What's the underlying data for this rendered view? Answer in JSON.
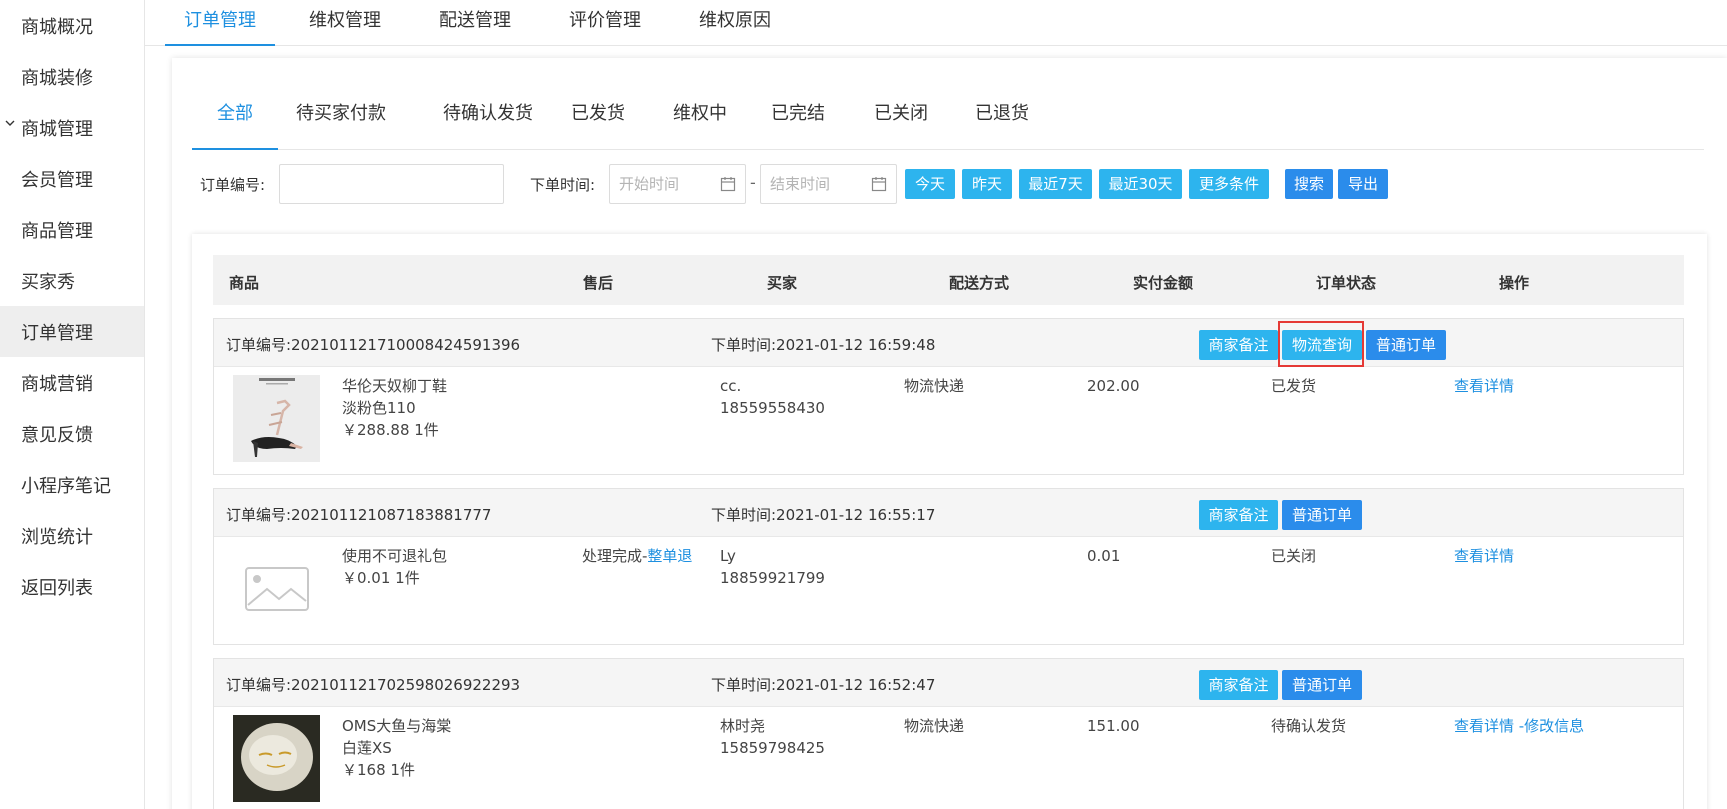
{
  "sidebar": {
    "items": [
      {
        "label": "商城概况"
      },
      {
        "label": "商城装修"
      },
      {
        "label": "商城管理"
      },
      {
        "label": "会员管理"
      },
      {
        "label": "商品管理"
      },
      {
        "label": "买家秀"
      },
      {
        "label": "订单管理"
      },
      {
        "label": "商城营销"
      },
      {
        "label": "意见反馈"
      },
      {
        "label": "小程序笔记"
      },
      {
        "label": "浏览统计"
      },
      {
        "label": "返回列表"
      }
    ]
  },
  "top_tabs": [
    "订单管理",
    "维权管理",
    "配送管理",
    "评价管理",
    "维权原因"
  ],
  "sub_tabs": [
    "全部",
    "待买家付款",
    "待确认发货",
    "已发货",
    "维权中",
    "已完结",
    "已关闭",
    "已退货"
  ],
  "filter": {
    "order_no_label": "订单编号:",
    "order_no_value": "",
    "time_label": "下单时间:",
    "start_placeholder": "开始时间",
    "end_placeholder": "结束时间",
    "dash": "-",
    "quick_buttons": [
      "今天",
      "昨天",
      "最近7天",
      "最近30天",
      "更多条件"
    ],
    "search_label": "搜索",
    "export_label": "导出"
  },
  "table": {
    "headers": [
      "商品",
      "售后",
      "买家",
      "配送方式",
      "实付金额",
      "订单状态",
      "操作"
    ],
    "orders": [
      {
        "order_no": "订单编号:20210112171000842459​1396",
        "time": "下单时间:2021-01-12 16:59:48",
        "actions": [
          "商家备注",
          "物流查询",
          "普通订单"
        ],
        "product_name": "华伦天奴柳丁鞋",
        "product_spec": "淡粉色110",
        "product_price": "￥288.88   1件",
        "aftersale": "",
        "aftersale_link": "",
        "buyer_name": "cc.",
        "buyer_phone": "18559558430",
        "delivery": "物流快递",
        "amount": "202.00",
        "status": "已发货",
        "op": "查看详情"
      },
      {
        "order_no": "订单编号:202101121087183881777",
        "time": "下单时间:2021-01-12 16:55:17",
        "actions": [
          "商家备注",
          "普通订单"
        ],
        "product_name": "使用不可退礼包",
        "product_spec": "￥0.01   1件",
        "product_price": "",
        "aftersale": "处理完成-",
        "aftersale_link": "整单退",
        "buyer_name": "Ly",
        "buyer_phone": "18859921799",
        "delivery": "",
        "amount": "0.01",
        "status": "已关闭",
        "op": "查看详情"
      },
      {
        "order_no": "订单编号:202101121702598026922293",
        "time": "下单时间:2021-01-12 16:52:47",
        "actions": [
          "商家备注",
          "普通订单"
        ],
        "product_name": "OMS大鱼与海棠",
        "product_spec": "白莲XS",
        "product_price": "￥168   1件",
        "aftersale": "",
        "aftersale_link": "",
        "buyer_name": "林时尧",
        "buyer_phone": "15859798425",
        "delivery": "物流快递",
        "amount": "151.00",
        "status": "待确认发货",
        "op": "查看详情 -修改信息"
      }
    ]
  },
  "colors": {
    "accent": "#1E90E0",
    "button_cyan": "#2DB4EE",
    "button_blue": "#2B8CEB",
    "highlight": "#E53935"
  },
  "icons": [
    "chevron-down-icon",
    "calendar-icon",
    "image-placeholder-icon"
  ]
}
